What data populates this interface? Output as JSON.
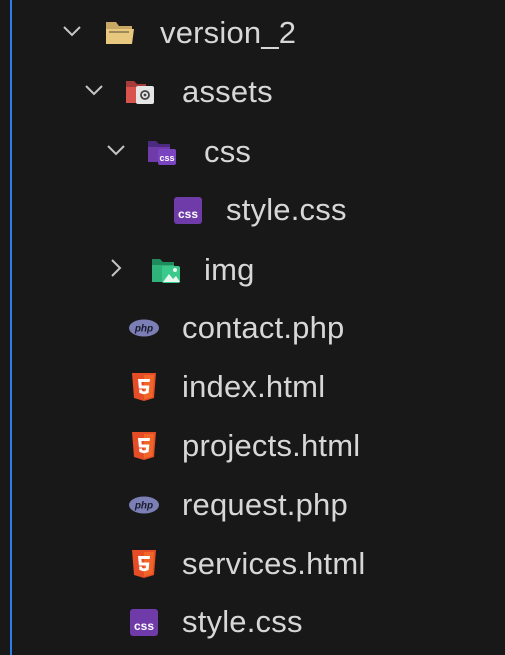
{
  "explorer": {
    "items": [
      {
        "label": "version_2",
        "kind": "folder",
        "icon": "folder-icon",
        "state": "expanded"
      },
      {
        "label": "assets",
        "kind": "folder",
        "icon": "assets-folder-icon",
        "state": "expanded"
      },
      {
        "label": "css",
        "kind": "folder",
        "icon": "css-folder-icon",
        "state": "expanded"
      },
      {
        "label": "style.css",
        "kind": "file",
        "icon": "css-file-icon"
      },
      {
        "label": "img",
        "kind": "folder",
        "icon": "image-folder-icon",
        "state": "collapsed"
      },
      {
        "label": "contact.php",
        "kind": "file",
        "icon": "php-file-icon"
      },
      {
        "label": "index.html",
        "kind": "file",
        "icon": "html-file-icon"
      },
      {
        "label": "projects.html",
        "kind": "file",
        "icon": "html-file-icon"
      },
      {
        "label": "request.php",
        "kind": "file",
        "icon": "php-file-icon"
      },
      {
        "label": "services.html",
        "kind": "file",
        "icon": "html-file-icon"
      },
      {
        "label": "style.css",
        "kind": "file",
        "icon": "css-file-icon"
      }
    ],
    "icon_text": {
      "css": "css",
      "php": "php"
    },
    "colors": {
      "background": "#181818",
      "text": "#d7d7d7",
      "chevron": "#c5c5c5",
      "indent_guide": "#2b7de9",
      "folder": "#e8c77f",
      "css": "#6f3ba8",
      "php": "#7b7fb5",
      "html": "#e44d26",
      "image_folder": "#2fb37a",
      "assets_folder": "#d9534f"
    }
  }
}
